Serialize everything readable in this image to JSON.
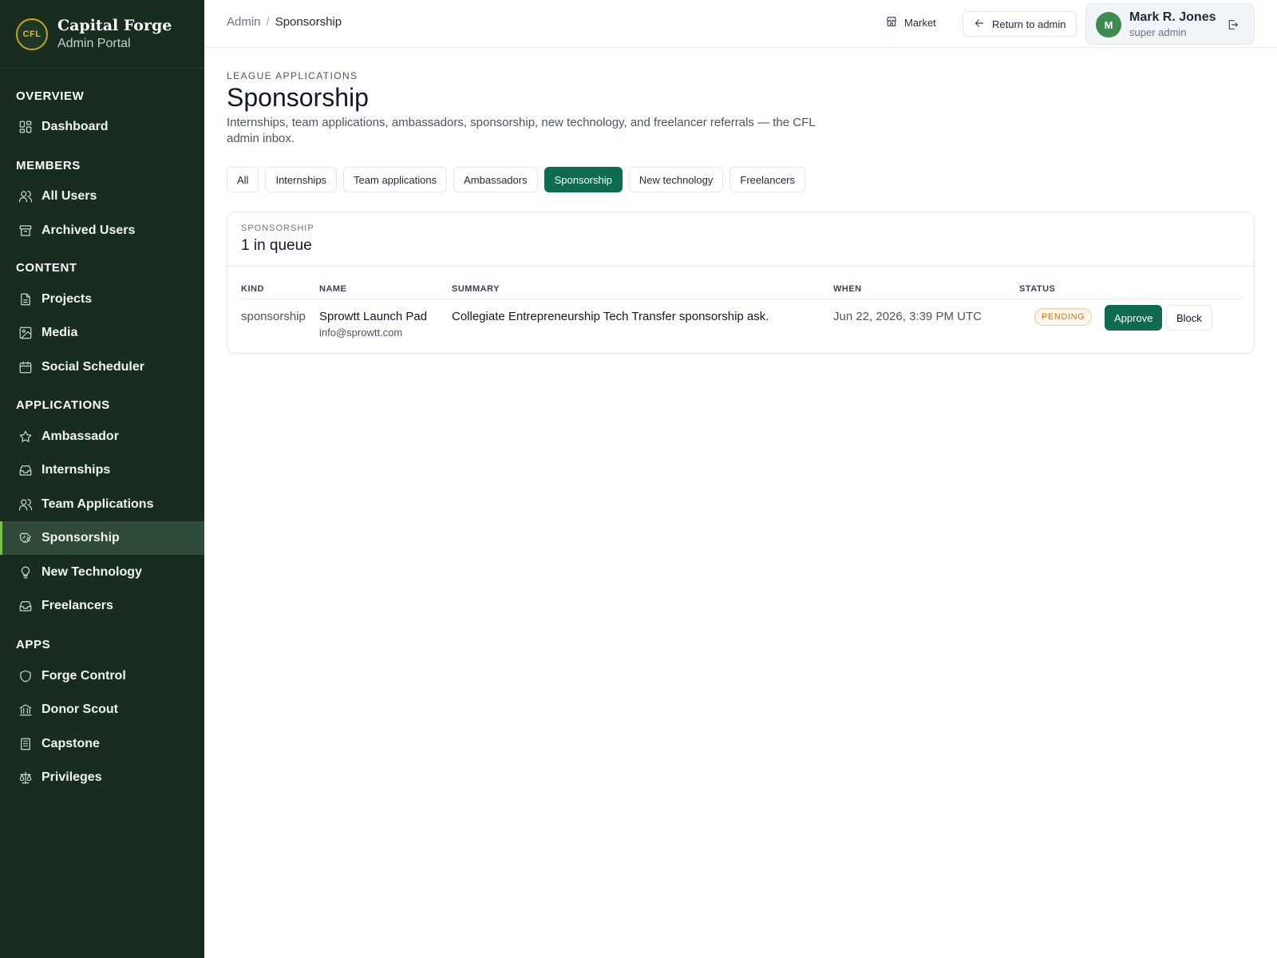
{
  "brand": {
    "logo_text": "CFL",
    "title": "Capital Forge",
    "subtitle": "Admin Portal"
  },
  "sidebar": {
    "sections": [
      {
        "label": "OVERVIEW"
      },
      {
        "label": "MEMBERS"
      },
      {
        "label": "CONTENT"
      },
      {
        "label": "APPLICATIONS"
      },
      {
        "label": "APPS"
      }
    ],
    "items": [
      {
        "label": "Dashboard",
        "icon": "dashboard-icon"
      },
      {
        "label": "All Users",
        "icon": "users-icon"
      },
      {
        "label": "Archived Users",
        "icon": "archive-icon"
      },
      {
        "label": "Projects",
        "icon": "file-icon"
      },
      {
        "label": "Media",
        "icon": "image-icon"
      },
      {
        "label": "Social Scheduler",
        "icon": "calendar-icon"
      },
      {
        "label": "Ambassador",
        "icon": "star-icon"
      },
      {
        "label": "Internships",
        "icon": "inbox-icon"
      },
      {
        "label": "Team Applications",
        "icon": "users-icon"
      },
      {
        "label": "Sponsorship",
        "icon": "handshake-icon",
        "active": true
      },
      {
        "label": "New Technology",
        "icon": "lightbulb-icon"
      },
      {
        "label": "Freelancers",
        "icon": "inbox-icon"
      },
      {
        "label": "Forge Control",
        "icon": "shield-icon"
      },
      {
        "label": "Donor Scout",
        "icon": "bank-icon"
      },
      {
        "label": "Capstone",
        "icon": "building-icon"
      },
      {
        "label": "Privileges",
        "icon": "scale-icon"
      }
    ]
  },
  "header": {
    "breadcrumb": [
      "Admin",
      "Sponsorship"
    ],
    "breadcrumb_sep": "/",
    "market_label": "Market",
    "return_label": "Return to admin",
    "user": {
      "initial": "M",
      "name": "Mark R. Jones",
      "role": "super admin"
    }
  },
  "page": {
    "eyebrow": "LEAGUE APPLICATIONS",
    "title": "Sponsorship",
    "description": "Internships, team applications, ambassadors, sponsorship, new technology, and freelancer referrals — the CFL admin inbox.",
    "tabs": [
      {
        "label": "All"
      },
      {
        "label": "Internships"
      },
      {
        "label": "Team applications"
      },
      {
        "label": "Ambassadors"
      },
      {
        "label": "Sponsorship",
        "active": true
      },
      {
        "label": "New technology"
      },
      {
        "label": "Freelancers"
      }
    ]
  },
  "queue": {
    "eyebrow": "SPONSORSHIP",
    "title": "1 in queue",
    "columns": [
      "KIND",
      "NAME",
      "SUMMARY",
      "WHEN",
      "STATUS"
    ],
    "rows": [
      {
        "kind": "sponsorship",
        "name": "Sprowtt Launch Pad",
        "email": "info@sprowtt.com",
        "summary": "Collegiate Entrepreneurship Tech Transfer sponsorship ask.",
        "when": "Jun 22, 2026, 3:39 PM UTC",
        "status": "PENDING",
        "approve_label": "Approve",
        "block_label": "Block"
      }
    ]
  },
  "colors": {
    "sidebar_bg": "#182d20",
    "accent": "#0f6b4f",
    "active_bar": "#7cbf4a",
    "pending": "#d97706"
  }
}
